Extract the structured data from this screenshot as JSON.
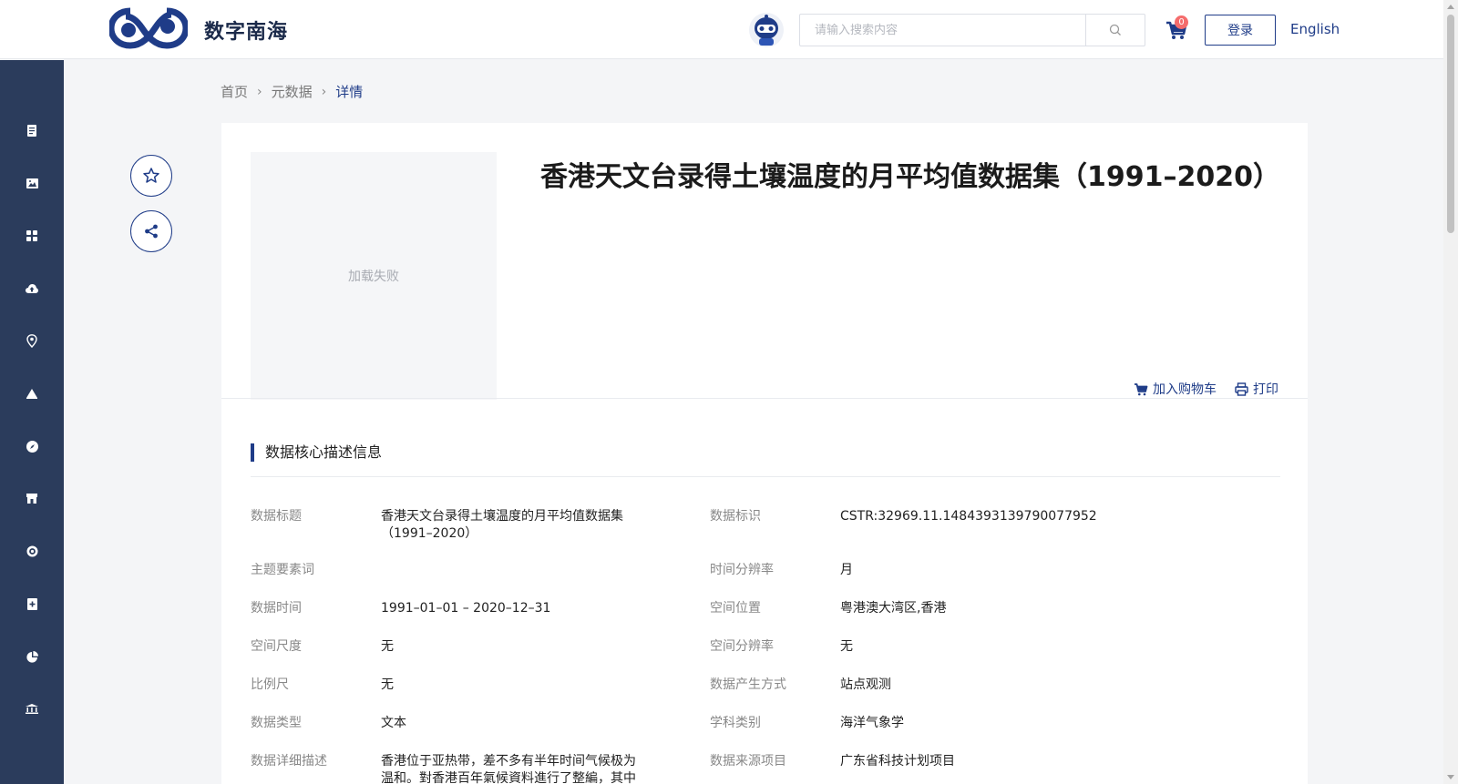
{
  "header": {
    "brand": "数字南海",
    "search_placeholder": "请输入搜索内容",
    "cart_count": "0",
    "login_label": "登录",
    "lang_label": "English"
  },
  "sidebar": {
    "icons": [
      "document-icon",
      "image-icon",
      "grid-icon",
      "cloud-upload-icon",
      "location-pin-icon",
      "mountain-icon",
      "compass-icon",
      "store-icon",
      "target-icon",
      "add-document-icon",
      "pie-chart-icon",
      "library-icon"
    ]
  },
  "breadcrumb": {
    "home": "首页",
    "metadata": "元数据",
    "current": "详情"
  },
  "dataset": {
    "thumb_text": "加载失败",
    "title": "香港天文台录得土壤温度的月平均值数据集（1991–2020）",
    "add_cart_label": "加入购物车",
    "print_label": "打印"
  },
  "section": {
    "title": "数据核心描述信息"
  },
  "fields": {
    "left": [
      {
        "label": "数据标题",
        "value": "香港天文台录得土壤温度的月平均值数据集（1991–2020）"
      },
      {
        "label": "主题要素词",
        "value": ""
      },
      {
        "label": "数据时间",
        "value": "1991–01–01 – 2020–12–31"
      },
      {
        "label": "空间尺度",
        "value": "无"
      },
      {
        "label": "比例尺",
        "value": "无"
      },
      {
        "label": "数据类型",
        "value": "文本"
      },
      {
        "label": "数据详细描述",
        "value": "香港位于亚热带，差不多有半年时间气候极为温和。對香港百年氣候資料進行了整編，其中"
      }
    ],
    "right": [
      {
        "label": "数据标识",
        "value": "CSTR:32969.11.1484393139790077952"
      },
      {
        "label": "时间分辨率",
        "value": "月"
      },
      {
        "label": "空间位置",
        "value": "粤港澳大湾区,香港"
      },
      {
        "label": "空间分辨率",
        "value": "无"
      },
      {
        "label": "数据产生方式",
        "value": "站点观测"
      },
      {
        "label": "学科类别",
        "value": "海洋气象学"
      },
      {
        "label": "数据来源项目",
        "value": "广东省科技计划项目"
      }
    ]
  },
  "colors": {
    "primary": "#1f3c88",
    "sidebar": "#2b3c5c",
    "badge": "#f56c6c"
  }
}
